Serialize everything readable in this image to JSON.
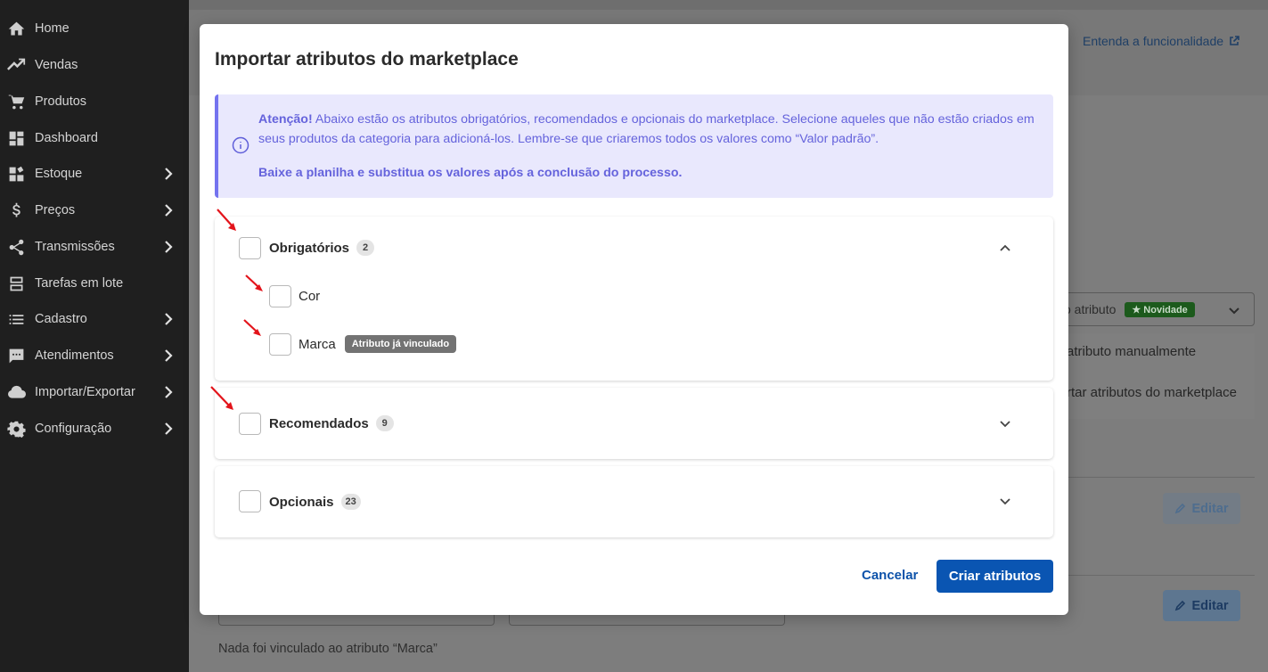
{
  "sidebar": {
    "items": [
      {
        "label": "Home",
        "icon": "home-icon",
        "has_chevron": false
      },
      {
        "label": "Vendas",
        "icon": "trending-up-icon",
        "has_chevron": false
      },
      {
        "label": "Produtos",
        "icon": "cart-icon",
        "has_chevron": false
      },
      {
        "label": "Dashboard",
        "icon": "dashboard-icon",
        "has_chevron": false
      },
      {
        "label": "Estoque",
        "icon": "stock-icon",
        "has_chevron": true
      },
      {
        "label": "Preços",
        "icon": "dollar-icon",
        "has_chevron": true
      },
      {
        "label": "Transmissões",
        "icon": "share-icon",
        "has_chevron": true
      },
      {
        "label": "Tarefas em lote",
        "icon": "batch-icon",
        "has_chevron": false
      },
      {
        "label": "Cadastro",
        "icon": "list-icon",
        "has_chevron": true
      },
      {
        "label": "Atendimentos",
        "icon": "chat-icon",
        "has_chevron": true
      },
      {
        "label": "Importar/Exportar",
        "icon": "cloud-icon",
        "has_chevron": true
      },
      {
        "label": "Configuração",
        "icon": "gear-icon",
        "has_chevron": true
      }
    ]
  },
  "background": {
    "help_link": "Entenda a funcionalidade",
    "dropdown_text": "vo atributo",
    "dropdown_badge": "★ Novidade",
    "menu_item_1": "atributo manualmente",
    "menu_item_2": "rtar atributos do marketplace",
    "edit_label": "Editar",
    "note": "Nada foi vinculado ao atributo “Marca”"
  },
  "modal": {
    "title": "Importar atributos do marketplace",
    "alert": {
      "lead": "Atenção!",
      "text": " Abaixo estão os atributos obrigatórios, recomendados e opcionais do marketplace. Selecione aqueles que não estão criados em seus produtos da categoria para adicioná-los. Lembre-se que criaremos todos os valores como “Valor padrão”.",
      "strong": "Baixe a planilha e substitua os valores após a conclusão do processo."
    },
    "sections": {
      "required": {
        "label": "Obrigatórios",
        "count": "2",
        "expanded": true,
        "items": [
          {
            "label": "Cor"
          },
          {
            "label": "Marca",
            "badge": "Atributo já vinculado"
          }
        ]
      },
      "recommended": {
        "label": "Recomendados",
        "count": "9",
        "expanded": false
      },
      "optional": {
        "label": "Opcionais",
        "count": "23",
        "expanded": false
      }
    },
    "cancel_label": "Cancelar",
    "create_label": "Criar atributos"
  },
  "colors": {
    "primary": "#0a55b2",
    "alert_bg": "#e9e8fd",
    "alert_text": "#6563dc",
    "annotation_arrow": "#e3141b"
  }
}
